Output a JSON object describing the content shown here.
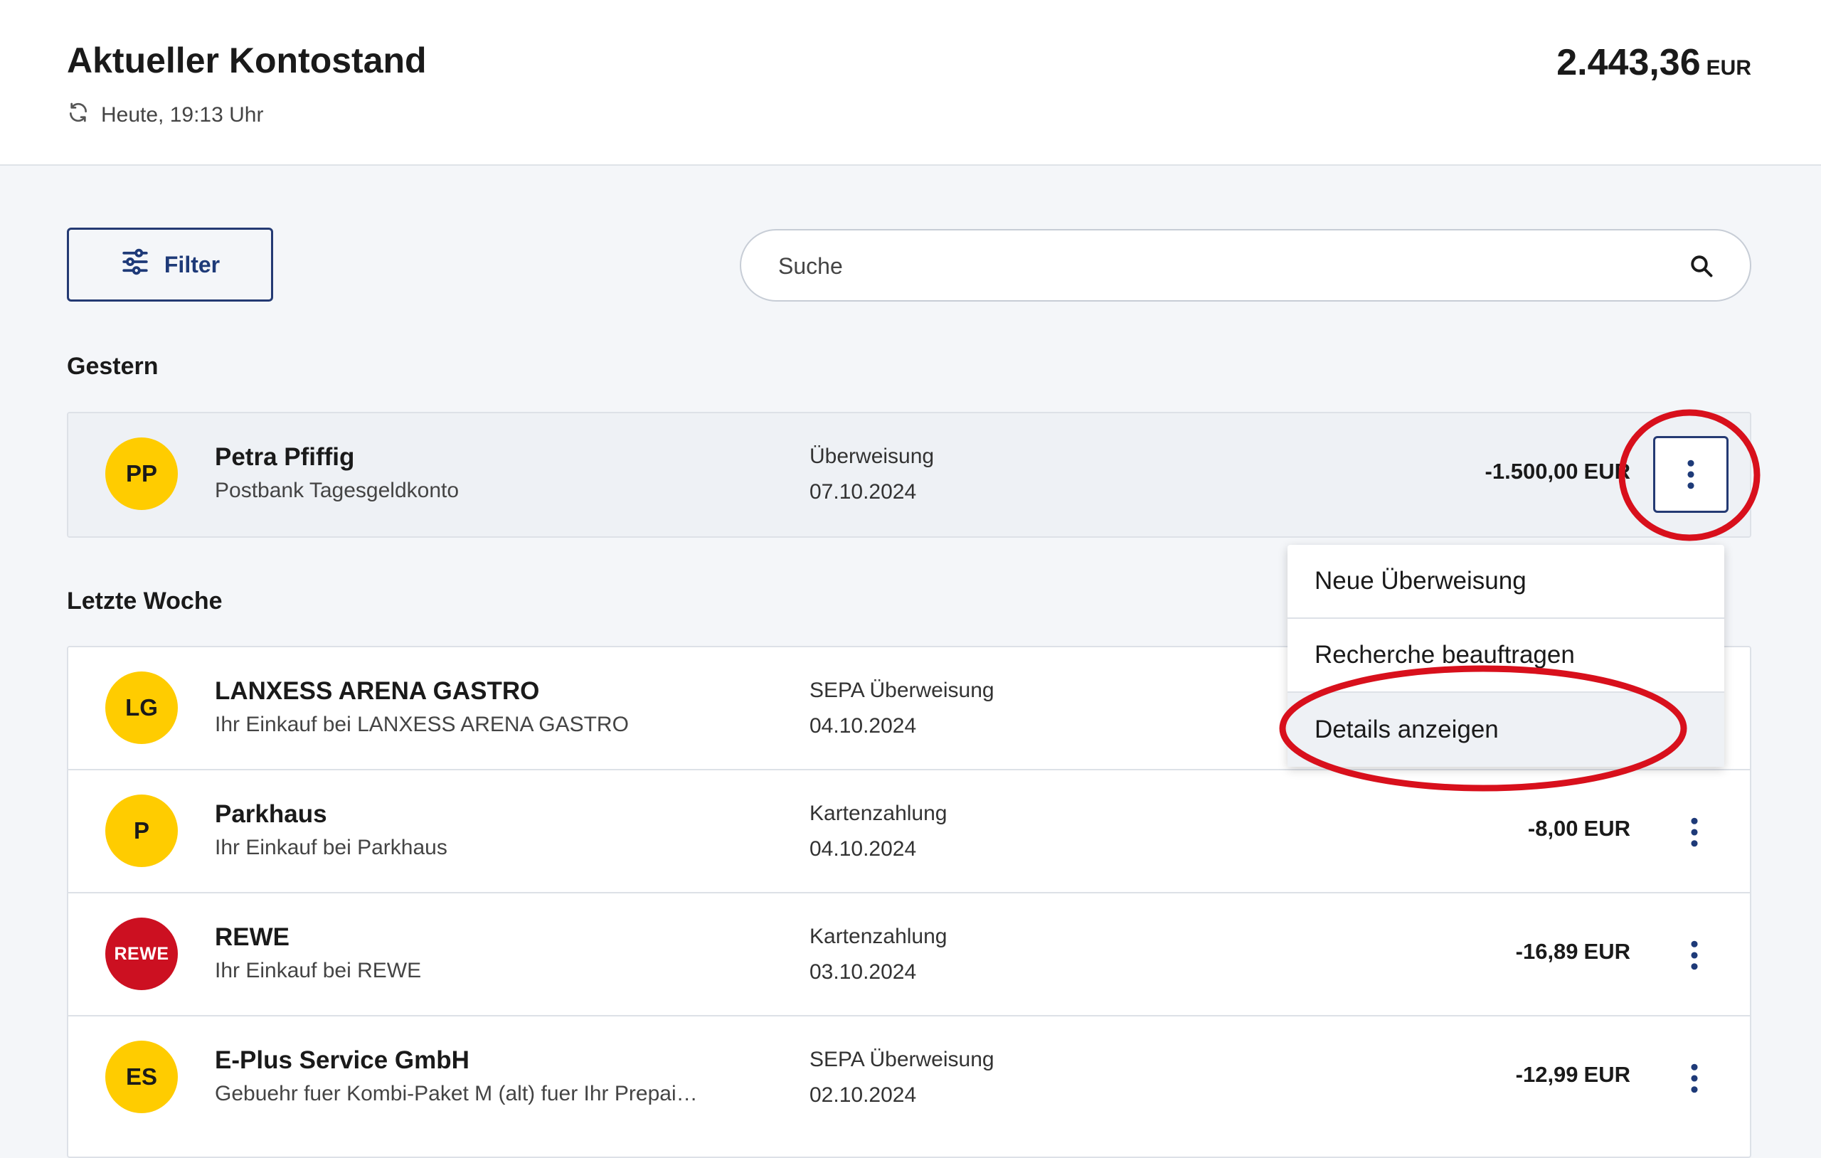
{
  "header": {
    "title": "Aktueller Kontostand",
    "updated": "Heute, 19:13 Uhr",
    "balance": "2.443,36",
    "currency": "EUR"
  },
  "toolbar": {
    "filter_label": "Filter",
    "search_placeholder": "Suche"
  },
  "groups": [
    {
      "label": "Gestern",
      "rows": [
        {
          "initials": "PP",
          "name": "Petra Pfiffig",
          "sub": "Postbank Tagesgeldkonto",
          "type": "Überweisung",
          "date": "07.10.2024",
          "amount": "-1.500,00",
          "currency": "EUR"
        }
      ]
    },
    {
      "label": "Letzte Woche",
      "rows": [
        {
          "initials": "LG",
          "name": "LANXESS ARENA GASTRO",
          "sub": "Ihr Einkauf bei LANXESS ARENA GASTRO",
          "type": "SEPA Überweisung",
          "date": "04.10.2024",
          "amount": "",
          "currency": ""
        },
        {
          "initials": "P",
          "name": "Parkhaus",
          "sub": "Ihr Einkauf bei Parkhaus",
          "type": "Kartenzahlung",
          "date": "04.10.2024",
          "amount": "-8,00",
          "currency": "EUR"
        },
        {
          "initials": "REWE",
          "name": "REWE",
          "sub": "Ihr Einkauf bei REWE",
          "type": "Kartenzahlung",
          "date": "03.10.2024",
          "amount": "-16,89",
          "currency": "EUR"
        },
        {
          "initials": "ES",
          "name": "E-Plus Service GmbH",
          "sub": "Gebuehr fuer Kombi-Paket M (alt) fuer Ihr Prepai…",
          "type": "SEPA Überweisung",
          "date": "02.10.2024",
          "amount": "-12,99",
          "currency": "EUR"
        }
      ]
    }
  ],
  "context_menu": {
    "items": [
      "Neue Überweisung",
      "Recherche beauftragen",
      "Details anzeigen"
    ]
  },
  "colors": {
    "accent": "#1e3a78",
    "avatar_yellow": "#ffcc00",
    "rewe_red": "#cc1021",
    "annotation_red": "#d8101c"
  },
  "icons": {
    "refresh": "refresh-icon",
    "filter": "sliders-icon",
    "search": "search-icon",
    "more": "more-vertical-icon"
  }
}
